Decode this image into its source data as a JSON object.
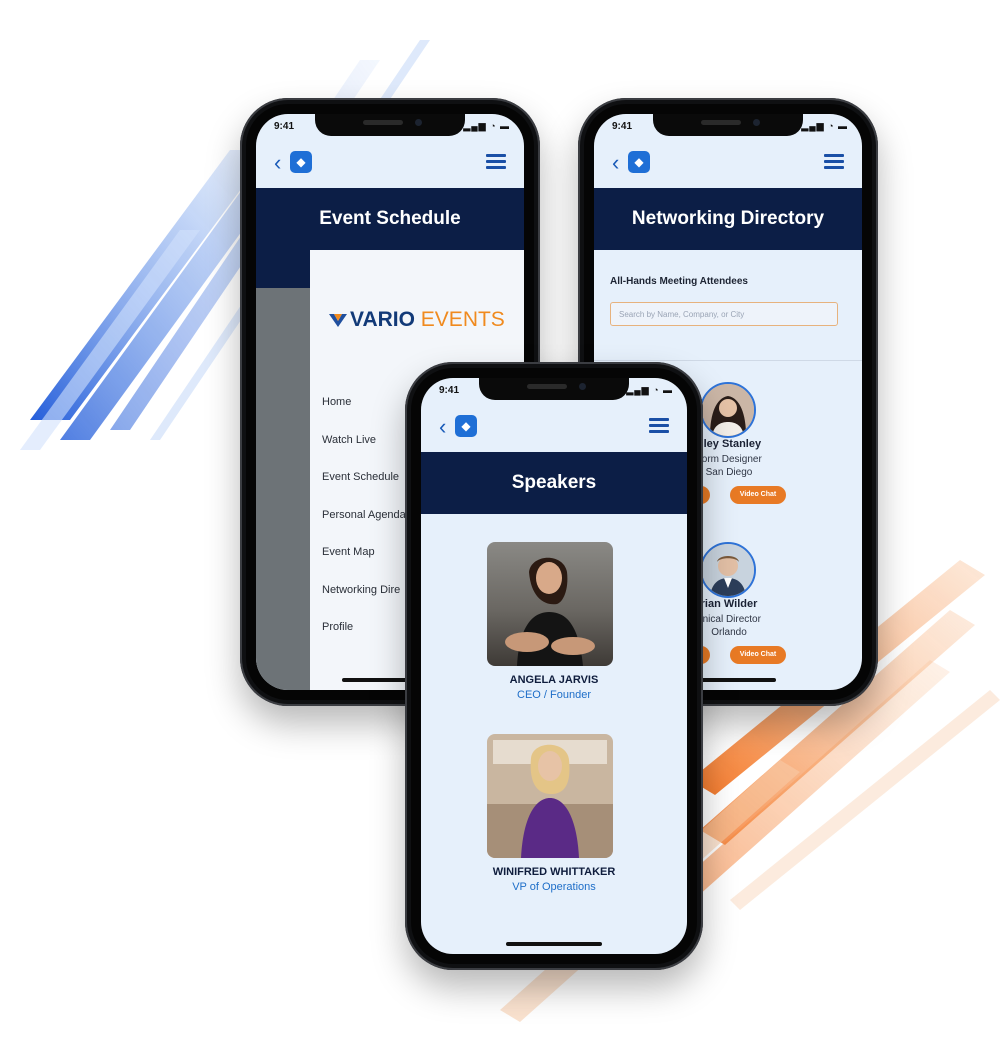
{
  "status": {
    "time": "9:41",
    "icons": "signal-wifi-battery"
  },
  "colors": {
    "navy": "#0c1e46",
    "accent_blue": "#1f6fd6",
    "accent_orange": "#e87a25",
    "screen_bg": "#e6f0fb"
  },
  "schedule_phone": {
    "title": "Event Schedule",
    "brand": {
      "word1": "VARIO",
      "word2": "EVENTS"
    },
    "menu_items": [
      "Home",
      "Watch Live",
      "Event Schedule",
      "Personal Agenda",
      "Event Map",
      "Networking Dire",
      "Profile"
    ]
  },
  "directory_phone": {
    "title": "Networking Directory",
    "section_heading": "All-Hands Meeting Attendees",
    "search_placeholder": "Search by Name, Company, or City",
    "attendees": [
      {
        "name": "nley Stanley",
        "role": "tform Designer",
        "city": "San Diego",
        "chat_label": "Video Chat"
      },
      {
        "name": "rian Wilder",
        "role": "hnical Director",
        "city": "Orlando",
        "chat_label": "Video Chat"
      }
    ]
  },
  "speakers_phone": {
    "title": "Speakers",
    "speakers": [
      {
        "name": "ANGELA JARVIS",
        "title": "CEO / Founder"
      },
      {
        "name": "WINIFRED WHITTAKER",
        "title": "VP of Operations"
      }
    ]
  }
}
